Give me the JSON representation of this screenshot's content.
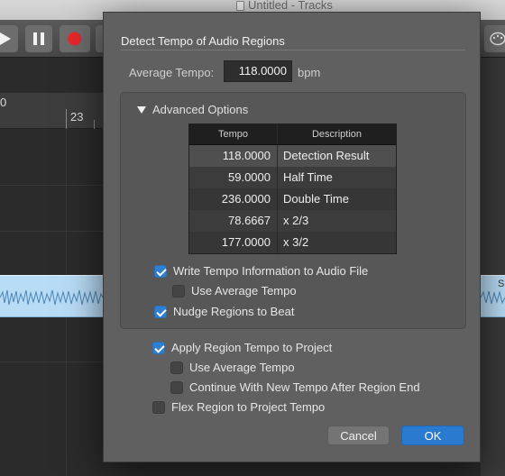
{
  "window": {
    "title": "Untitled - Tracks"
  },
  "toolbar": {
    "play_icon": "play-icon",
    "pause_icon": "pause-icon",
    "record_icon": "record-icon",
    "record_color": "#e8272b"
  },
  "ruler": {
    "bar_left": "0",
    "bar_23": "23"
  },
  "region": {
    "edge_label": "S",
    "color": "#b9dcf6"
  },
  "dialog": {
    "title": "Detect Tempo of Audio Regions",
    "average_tempo_label": "Average Tempo:",
    "average_tempo_value": "118.0000",
    "average_tempo_unit": "bpm",
    "advanced_options_label": "Advanced Options",
    "table": {
      "headers": [
        "Tempo",
        "Description"
      ],
      "rows": [
        {
          "tempo": "118.0000",
          "description": "Detection Result"
        },
        {
          "tempo": "59.0000",
          "description": "Half Time"
        },
        {
          "tempo": "236.0000",
          "description": "Double Time"
        },
        {
          "tempo": "78.6667",
          "description": "x 2/3"
        },
        {
          "tempo": "177.0000",
          "description": "x 3/2"
        }
      ]
    },
    "options": {
      "write_tempo": {
        "label": "Write Tempo Information to Audio File",
        "checked": true
      },
      "use_average_1": {
        "label": "Use Average Tempo",
        "checked": false
      },
      "nudge_regions": {
        "label": "Nudge Regions to Beat",
        "checked": true
      },
      "apply_region_tempo": {
        "label": "Apply Region Tempo to Project",
        "checked": true
      },
      "use_average_2": {
        "label": "Use Average Tempo",
        "checked": false
      },
      "continue_new_tempo": {
        "label": "Continue With New Tempo After Region End",
        "checked": false
      },
      "flex_region": {
        "label": "Flex Region to Project Tempo",
        "checked": false
      }
    },
    "cancel_label": "Cancel",
    "ok_label": "OK",
    "accent_color": "#2a7ad0"
  }
}
